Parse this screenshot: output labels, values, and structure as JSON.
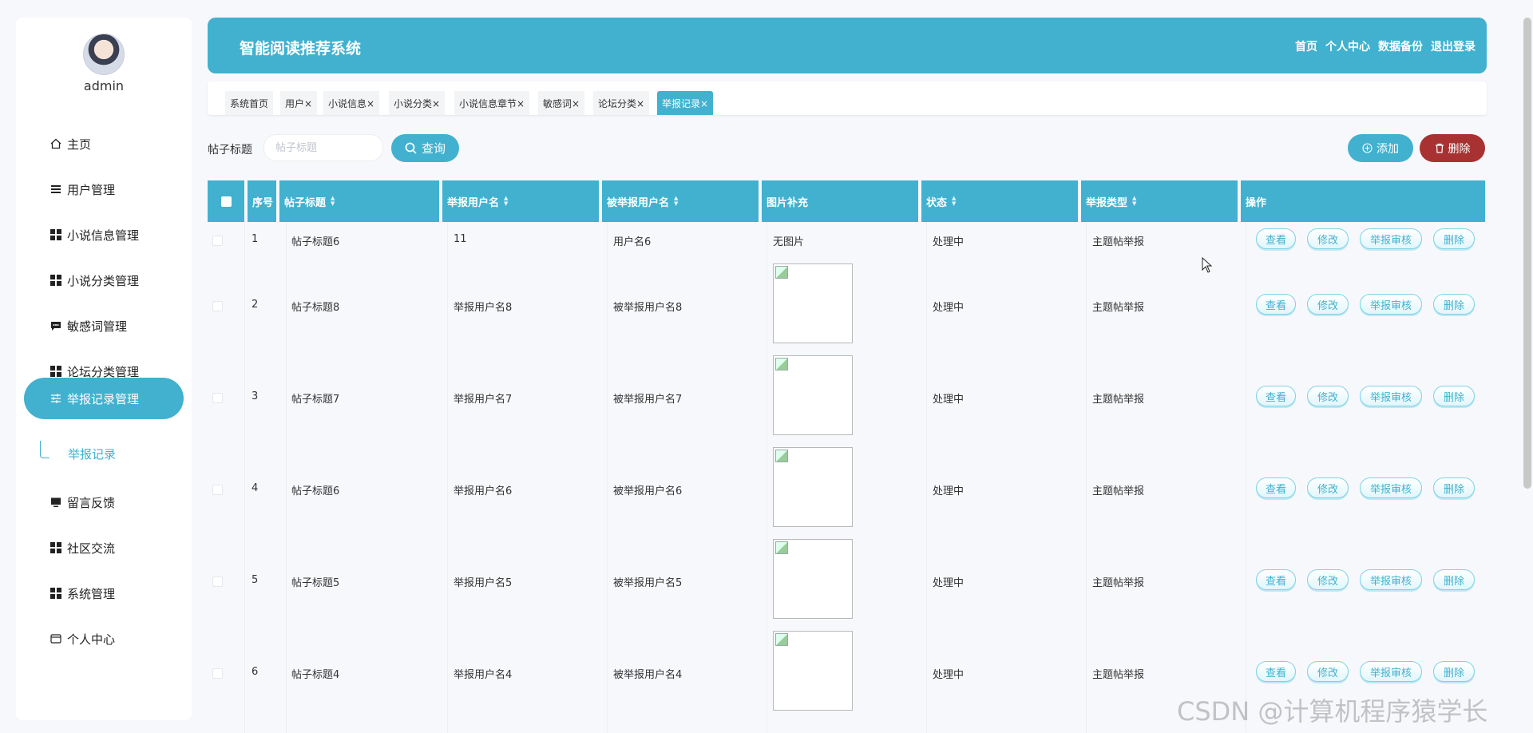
{
  "sidebar": {
    "username": "admin",
    "items": [
      {
        "label": "主页",
        "icon": "home-icon"
      },
      {
        "label": "用户管理",
        "icon": "list-icon"
      },
      {
        "label": "小说信息管理",
        "icon": "grid-icon"
      },
      {
        "label": "小说分类管理",
        "icon": "grid-icon"
      },
      {
        "label": "敏感词管理",
        "icon": "chat-icon"
      },
      {
        "label": "论坛分类管理",
        "icon": "grid-icon"
      },
      {
        "label": "举报记录管理",
        "icon": "sliders-icon"
      },
      {
        "label": "留言反馈",
        "icon": "monitor-icon"
      },
      {
        "label": "社区交流",
        "icon": "grid-icon"
      },
      {
        "label": "系统管理",
        "icon": "grid-icon"
      },
      {
        "label": "个人中心",
        "icon": "card-icon"
      }
    ],
    "active_sub": "举报记录"
  },
  "header": {
    "title": "智能阅读推荐系统",
    "links": [
      "首页",
      "个人中心",
      "数据备份",
      "退出登录"
    ]
  },
  "tabs": [
    {
      "label": "系统首页"
    },
    {
      "label": "用户×"
    },
    {
      "label": "小说信息×"
    },
    {
      "label": "小说分类×"
    },
    {
      "label": "小说信息章节×"
    },
    {
      "label": "敏感词×"
    },
    {
      "label": "论坛分类×"
    },
    {
      "label": "举报记录×"
    }
  ],
  "search": {
    "label": "帖子标题",
    "placeholder": "帖子标题",
    "query_button": "查询",
    "add_button": "添加",
    "delete_button": "删除"
  },
  "table": {
    "headers": [
      "序号",
      "帖子标题",
      "举报用户名",
      "被举报用户名",
      "图片补充",
      "状态",
      "举报类型",
      "操作"
    ],
    "actions": [
      "查看",
      "修改",
      "举报审核",
      "删除"
    ],
    "rows": [
      {
        "no": "1",
        "title": "帖子标题6",
        "reporter": "11",
        "reported": "用户名6",
        "image": "无图片",
        "status": "处理中",
        "type": "主题帖举报"
      },
      {
        "no": "2",
        "title": "帖子标题8",
        "reporter": "举报用户名8",
        "reported": "被举报用户名8",
        "image": "",
        "status": "处理中",
        "type": "主题帖举报"
      },
      {
        "no": "3",
        "title": "帖子标题7",
        "reporter": "举报用户名7",
        "reported": "被举报用户名7",
        "image": "",
        "status": "处理中",
        "type": "主题帖举报"
      },
      {
        "no": "4",
        "title": "帖子标题6",
        "reporter": "举报用户名6",
        "reported": "被举报用户名6",
        "image": "",
        "status": "处理中",
        "type": "主题帖举报"
      },
      {
        "no": "5",
        "title": "帖子标题5",
        "reporter": "举报用户名5",
        "reported": "被举报用户名5",
        "image": "",
        "status": "处理中",
        "type": "主题帖举报"
      },
      {
        "no": "6",
        "title": "帖子标题4",
        "reporter": "举报用户名4",
        "reported": "被举报用户名4",
        "image": "",
        "status": "处理中",
        "type": "主题帖举报"
      }
    ]
  },
  "watermark": "CSDN @计算机程序猿学长",
  "colors": {
    "primary": "#41b1cf",
    "danger": "#a83232"
  }
}
